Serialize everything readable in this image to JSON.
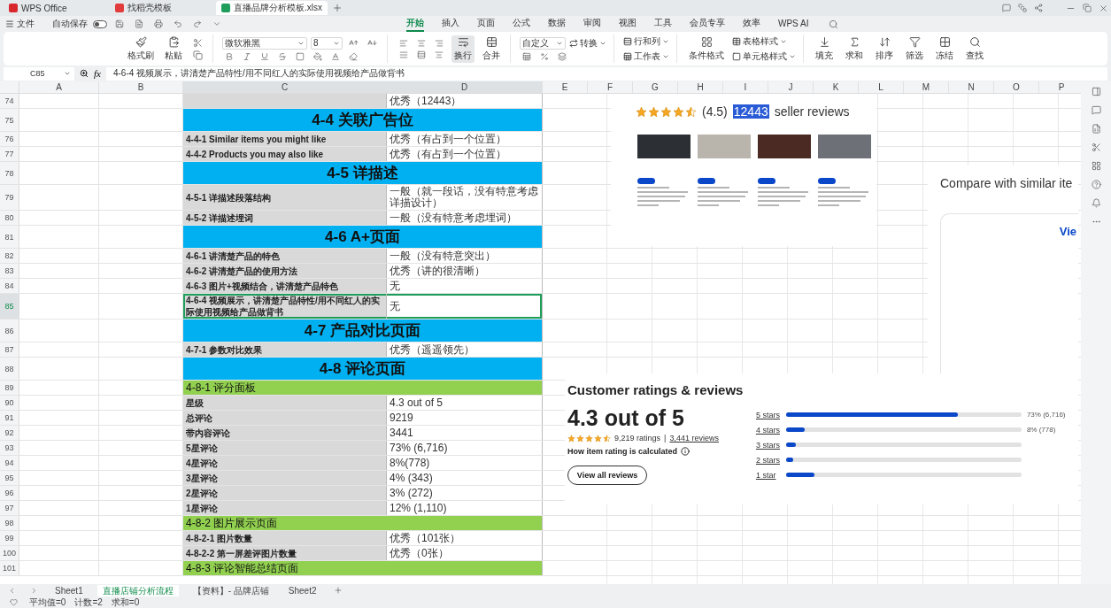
{
  "app_tabs": [
    {
      "label": "WPS Office",
      "kind": "home",
      "selected": false
    },
    {
      "label": "找稻壳模板",
      "kind": "template",
      "selected": false
    },
    {
      "label": "直播品牌分析模板.xlsx",
      "kind": "sheet",
      "selected": true
    }
  ],
  "quick_bar": {
    "file_menu": "文件",
    "autosave": {
      "label": "自动保存",
      "on": false
    }
  },
  "ribbon_tabs": [
    {
      "label": "开始",
      "selected": true
    },
    {
      "label": "插入",
      "selected": false
    },
    {
      "label": "页面",
      "selected": false
    },
    {
      "label": "公式",
      "selected": false
    },
    {
      "label": "数据",
      "selected": false
    },
    {
      "label": "审阅",
      "selected": false
    },
    {
      "label": "视图",
      "selected": false
    },
    {
      "label": "工具",
      "selected": false
    },
    {
      "label": "会员专享",
      "selected": false
    },
    {
      "label": "效率",
      "selected": false
    },
    {
      "label": "WPS AI",
      "selected": false
    }
  ],
  "ribbon": {
    "clipboard": [
      "格式刷",
      "粘贴"
    ],
    "font": "微软雅黑",
    "font_size": "8",
    "wrap": "换行",
    "merge": "合并",
    "number_format": "自定义",
    "convert": "转换",
    "sheet_tools": [
      "行和列",
      "工作表"
    ],
    "styles": [
      "条件格式",
      "表格样式",
      "单元格样式"
    ],
    "editing": [
      "填充",
      "求和",
      "排序",
      "筛选",
      "冻结",
      "查找"
    ]
  },
  "formula_bar": {
    "cell": "C85",
    "fx": "fx",
    "content": "4-6-4  视频展示，讲清楚产品特性/用不同红人的实际使用视频给产品做背书"
  },
  "columns": [
    {
      "label": "A",
      "selected": false
    },
    {
      "label": "B",
      "selected": false
    },
    {
      "label": "C",
      "selected": true
    },
    {
      "label": "D",
      "selected": true
    },
    {
      "label": "E",
      "selected": false
    },
    {
      "label": "F",
      "selected": false
    },
    {
      "label": "G",
      "selected": false
    },
    {
      "label": "H",
      "selected": false
    },
    {
      "label": "I",
      "selected": false
    },
    {
      "label": "J",
      "selected": false
    },
    {
      "label": "K",
      "selected": false
    },
    {
      "label": "L",
      "selected": false
    },
    {
      "label": "M",
      "selected": false
    },
    {
      "label": "N",
      "selected": false
    },
    {
      "label": "O",
      "selected": false
    },
    {
      "label": "P",
      "selected": false
    }
  ],
  "rows": [
    {
      "number": "74",
      "kind": "item",
      "selected": false,
      "value": "优秀（12443）"
    },
    {
      "number": "75",
      "kind": "section",
      "selected": false,
      "label": "4-4  关联广告位"
    },
    {
      "number": "76",
      "kind": "item",
      "selected": false,
      "label": "4-4-1 Similar items you might like",
      "value": "优秀（有占到一个位置）"
    },
    {
      "number": "77",
      "kind": "item",
      "selected": false,
      "label": "4-4-2 Products you may also like",
      "value": "优秀（有占到一个位置）"
    },
    {
      "number": "78",
      "kind": "section",
      "selected": false,
      "label": "4-5  详描述"
    },
    {
      "number": "79",
      "kind": "item",
      "selected": false,
      "label": "4-5-1  详描述段落结构",
      "value": "一般（就一段话，没有特意考虑详描设计）"
    },
    {
      "number": "80",
      "kind": "item",
      "selected": false,
      "label": "4-5-2  详描述埋词",
      "value": "一般（没有特意考虑埋词）"
    },
    {
      "number": "81",
      "kind": "section",
      "selected": false,
      "label": "4-6  A+页面"
    },
    {
      "number": "82",
      "kind": "item",
      "selected": false,
      "label": "4-6-1  讲清楚产品的特色",
      "value": "一般（没有特意突出）"
    },
    {
      "number": "83",
      "kind": "item",
      "selected": false,
      "label": "4-6-2  讲清楚产品的使用方法",
      "value": "优秀（讲的很清晰）"
    },
    {
      "number": "84",
      "kind": "item",
      "selected": false,
      "label": "4-6-3  图片+视频结合，讲清楚产品特色",
      "value": "无"
    },
    {
      "number": "85",
      "kind": "item",
      "selected": true,
      "label": "4-6-4  视频展示，讲清楚产品特性/用不同红人的实际使用视频给产品做背书",
      "value": "无"
    },
    {
      "number": "86",
      "kind": "section",
      "selected": false,
      "label": "4-7  产品对比页面"
    },
    {
      "number": "87",
      "kind": "item",
      "selected": false,
      "label": "4-7-1  参数对比效果",
      "value": "优秀（遥遥领先）"
    },
    {
      "number": "88",
      "kind": "section",
      "selected": false,
      "label": "4-8  评论页面"
    },
    {
      "number": "89",
      "kind": "subsection",
      "selected": false,
      "label": "4-8-1  评分面板"
    },
    {
      "number": "90",
      "kind": "item",
      "selected": false,
      "label": "星级",
      "value": "4.3 out of 5"
    },
    {
      "number": "91",
      "kind": "item",
      "selected": false,
      "label": "总评论",
      "value": "9219"
    },
    {
      "number": "92",
      "kind": "item",
      "selected": false,
      "label": "带内容评论",
      "value": "3441"
    },
    {
      "number": "93",
      "kind": "item",
      "selected": false,
      "label": "5星评论",
      "value": "73% (6,716)"
    },
    {
      "number": "94",
      "kind": "item",
      "selected": false,
      "label": "4星评论",
      "value": "8%(778)"
    },
    {
      "number": "95",
      "kind": "item",
      "selected": false,
      "label": "3星评论",
      "value": "4% (343)"
    },
    {
      "number": "96",
      "kind": "item",
      "selected": false,
      "label": "2星评论",
      "value": "3% (272)"
    },
    {
      "number": "97",
      "kind": "item",
      "selected": false,
      "label": "1星评论",
      "value": "12% (1,110)"
    },
    {
      "number": "98",
      "kind": "subsection",
      "selected": false,
      "label": "4-8-2  图片展示页面"
    },
    {
      "number": "99",
      "kind": "item",
      "selected": false,
      "label": "4-8-2-1  图片数量",
      "value": "优秀（101张）"
    },
    {
      "number": "100",
      "kind": "item",
      "selected": false,
      "label": "4-8-2-2  第一屏差评图片数量",
      "value": "优秀（0张）"
    },
    {
      "number": "101",
      "kind": "subsection",
      "selected": false,
      "label": "4-8-3  评论智能总结页面"
    }
  ],
  "seller_picture": {
    "stars": 4.5,
    "rating": "(4.5)",
    "count": "12443",
    "count_selected": true,
    "caption": "seller reviews"
  },
  "compare_picture": {
    "title": "Compare with similar ite",
    "link": "Vie"
  },
  "ratings_picture": {
    "title": "Customer ratings & reviews",
    "score": "4.3 out of 5",
    "stars": 4.5,
    "ratings": "9,219 ratings",
    "separator": "|",
    "reviews_link": "3,441 reviews",
    "how": "How item rating is calculated",
    "button": "View all reviews",
    "bars": [
      {
        "label": "5 stars",
        "level": 0.73,
        "reading": "73% (6,716)"
      },
      {
        "label": "4 stars",
        "level": 0.08,
        "reading": "8% (778)"
      },
      {
        "label": "3 stars",
        "level": 0.04
      },
      {
        "label": "2 stars",
        "level": 0.03
      },
      {
        "label": "1 star",
        "level": 0.12
      }
    ]
  },
  "sheet_tabs": [
    {
      "label": "Sheet1",
      "selected": false
    },
    {
      "label": "直播店铺分析流程",
      "selected": true
    },
    {
      "label": "【资料】- 品牌店铺",
      "selected": false
    },
    {
      "label": "Sheet2",
      "selected": false
    }
  ],
  "status_bar": {
    "items": [
      "平均值=0",
      "计数=2",
      "求和=0"
    ]
  }
}
